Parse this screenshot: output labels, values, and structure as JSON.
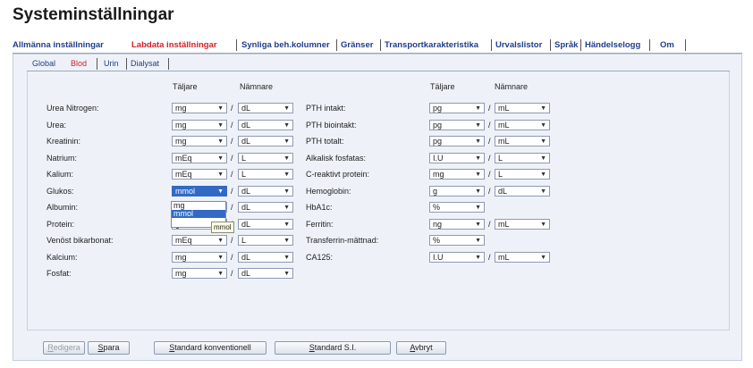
{
  "title": "Systeminställningar",
  "main_tabs": [
    {
      "label": "Allmänna inställningar"
    },
    {
      "label": "Labdata inställningar"
    },
    {
      "label": "Synliga beh.kolumner"
    },
    {
      "label": "Gränser"
    },
    {
      "label": "Transportkarakteristika"
    },
    {
      "label": "Urvalslistor"
    },
    {
      "label": "Språk"
    },
    {
      "label": "Händelselogg"
    },
    {
      "label": "Om"
    }
  ],
  "active_main_tab": "Labdata inställningar",
  "sub_tabs": [
    {
      "label": "Global"
    },
    {
      "label": "Blod"
    },
    {
      "label": "Urin"
    },
    {
      "label": "Dialysat"
    }
  ],
  "active_sub_tab": "Blod",
  "headers": {
    "numerator": "Täljare",
    "denominator": "Nämnare"
  },
  "left_rows": [
    {
      "label": "Urea Nitrogen:",
      "num": "mg",
      "den": "dL"
    },
    {
      "label": "Urea:",
      "num": "mg",
      "den": "dL"
    },
    {
      "label": "Kreatinin:",
      "num": "mg",
      "den": "dL"
    },
    {
      "label": "Natrium:",
      "num": "mEq",
      "den": "L"
    },
    {
      "label": "Kalium:",
      "num": "mEq",
      "den": "L"
    },
    {
      "label": "Glukos:",
      "num": "mmol",
      "den": "dL"
    },
    {
      "label": "Albumin:",
      "num": "mg",
      "den": "dL"
    },
    {
      "label": "Protein:",
      "num": "g",
      "den": "dL"
    },
    {
      "label": "Venöst bikarbonat:",
      "num": "mEq",
      "den": "L"
    },
    {
      "label": "Kalcium:",
      "num": "mg",
      "den": "dL"
    },
    {
      "label": "Fosfat:",
      "num": "mg",
      "den": "dL"
    }
  ],
  "right_rows": [
    {
      "label": "PTH intakt:",
      "num": "pg",
      "den": "mL"
    },
    {
      "label": "PTH biointakt:",
      "num": "pg",
      "den": "mL"
    },
    {
      "label": "PTH totalt:",
      "num": "pg",
      "den": "mL"
    },
    {
      "label": "Alkalisk fosfatas:",
      "num": "I.U",
      "den": "L"
    },
    {
      "label": "C-reaktivt protein:",
      "num": "mg",
      "den": "L"
    },
    {
      "label": "Hemoglobin:",
      "num": "g",
      "den": "dL"
    },
    {
      "label": "HbA1c:",
      "num": "%",
      "den": ""
    },
    {
      "label": "Ferritin:",
      "num": "ng",
      "den": "mL"
    },
    {
      "label": "Transferrin-mättnad:",
      "num": "%",
      "den": ""
    },
    {
      "label": "CA125:",
      "num": "I.U",
      "den": "mL"
    }
  ],
  "open_dropdown": {
    "options": [
      "mg",
      "mmol"
    ],
    "highlighted": "mmol"
  },
  "tooltip": "mmol",
  "buttons": [
    {
      "pre": "",
      "u": "R",
      "post": "edigera",
      "disabled": true
    },
    {
      "pre": "",
      "u": "S",
      "post": "para",
      "disabled": false
    },
    {
      "pre": "",
      "u": "S",
      "post": "tandard konventionell",
      "disabled": false
    },
    {
      "pre": "",
      "u": "S",
      "post": "tandard S.I.",
      "disabled": false
    },
    {
      "pre": "",
      "u": "A",
      "post": "vbryt",
      "disabled": false
    }
  ]
}
